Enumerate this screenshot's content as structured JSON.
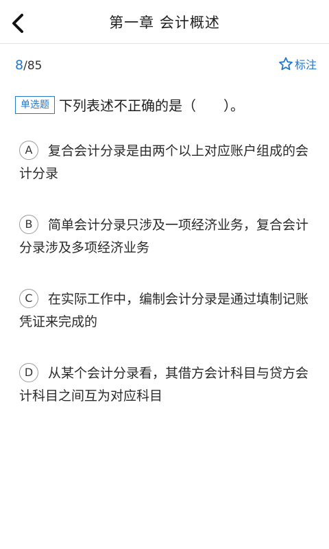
{
  "header": {
    "title": "第一章 会计概述"
  },
  "progress": {
    "current": "8",
    "total": "/85"
  },
  "mark": {
    "label": "标注"
  },
  "question": {
    "type": "单选题",
    "text": "下列表述不正确的是（　　）。"
  },
  "options": [
    {
      "letter": "A",
      "text": "复合会计分录是由两个以上对应账户组成的会计分录"
    },
    {
      "letter": "B",
      "text": "简单会计分录只涉及一项经济业务，复合会计分录涉及多项经济业务"
    },
    {
      "letter": "C",
      "text": "在实际工作中，编制会计分录是通过填制记账凭证来完成的"
    },
    {
      "letter": "D",
      "text": "从某个会计分录看，其借方会计科目与贷方会计科目之间互为对应科目"
    }
  ],
  "colors": {
    "accent": "#2477c9",
    "text": "#222222",
    "divider": "#e3e3e3"
  },
  "icons": {
    "back": "chevron-left-icon",
    "mark": "star-outline-icon"
  }
}
